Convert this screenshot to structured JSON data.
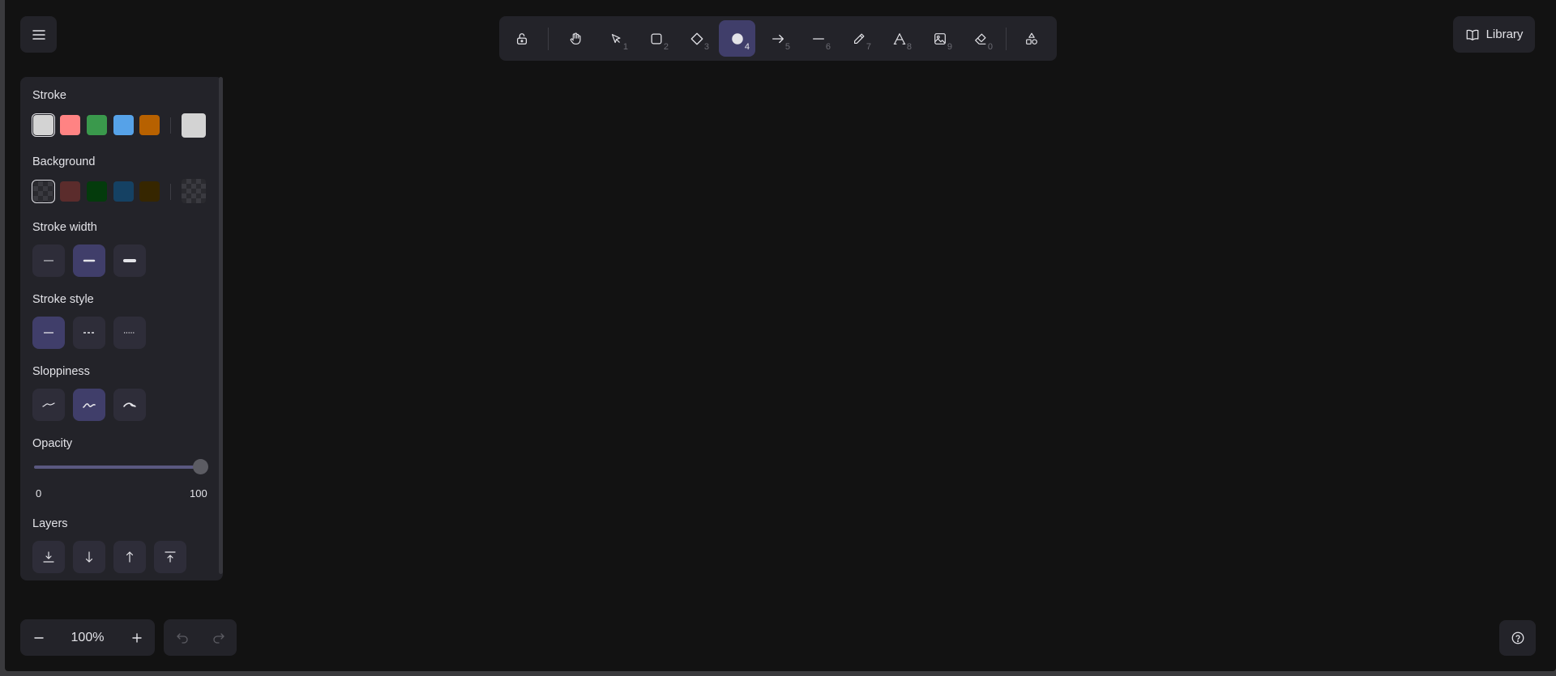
{
  "toolbar": {
    "tools": [
      {
        "name": "lock",
        "key": ""
      },
      {
        "name": "hand",
        "key": ""
      },
      {
        "name": "selection",
        "key": "1"
      },
      {
        "name": "rectangle",
        "key": "2"
      },
      {
        "name": "diamond",
        "key": "3"
      },
      {
        "name": "ellipse",
        "key": "4"
      },
      {
        "name": "arrow",
        "key": "5"
      },
      {
        "name": "line",
        "key": "6"
      },
      {
        "name": "draw",
        "key": "7"
      },
      {
        "name": "text",
        "key": "8"
      },
      {
        "name": "image",
        "key": "9"
      },
      {
        "name": "eraser",
        "key": "0"
      },
      {
        "name": "extra-tools",
        "key": ""
      }
    ],
    "active_tool": "ellipse"
  },
  "library": {
    "label": "Library"
  },
  "properties": {
    "stroke": {
      "title": "Stroke",
      "colors": [
        "#d3d3d3",
        "#ff8383",
        "#3a994c",
        "#56a2e8",
        "#b76100"
      ],
      "selected": "#d3d3d3",
      "current": "#d3d3d3"
    },
    "background": {
      "title": "Background",
      "colors": [
        "transparent",
        "#5b2c2c",
        "#043b0c",
        "#154163",
        "#362600"
      ],
      "selected": "transparent",
      "current": "transparent"
    },
    "stroke_width": {
      "title": "Stroke width",
      "active_index": 1
    },
    "stroke_style": {
      "title": "Stroke style",
      "active_index": 0
    },
    "sloppiness": {
      "title": "Sloppiness",
      "active_index": 1
    },
    "opacity": {
      "title": "Opacity",
      "min": "0",
      "max": "100",
      "value": 100
    },
    "layers": {
      "title": "Layers"
    }
  },
  "zoom": {
    "value": "100%"
  }
}
